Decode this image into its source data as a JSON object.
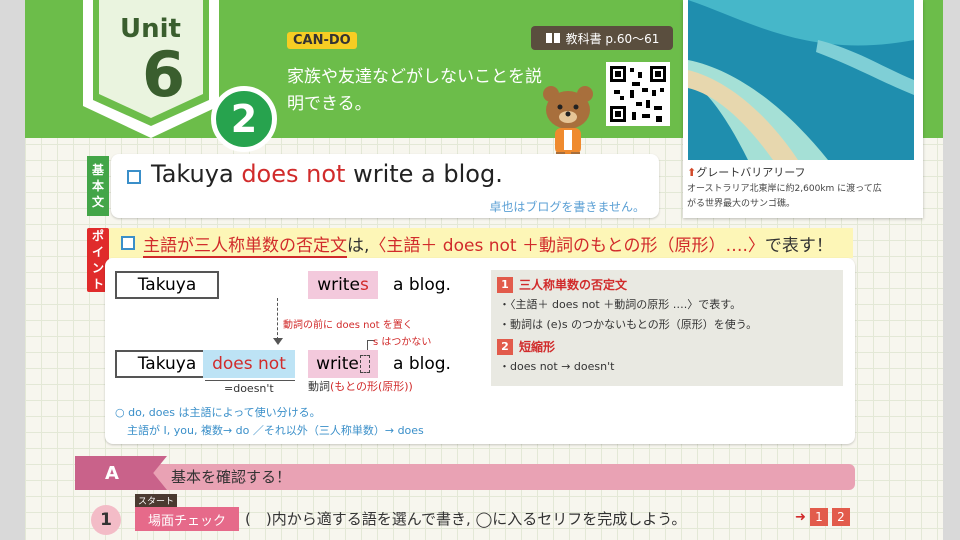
{
  "unit": {
    "word": "Unit",
    "number": "6",
    "part": "2"
  },
  "cando": {
    "label": "CAN-DO",
    "text": "家族や友達などがしないことを説明できる。"
  },
  "textbook": {
    "icon": "book-icon",
    "label": "教科書 p.60〜61"
  },
  "photo": {
    "title": "グレートバリアリーフ",
    "caption": "オーストラリア北東岸に約2,600km に渡って広がる世界最大のサンゴ礁。"
  },
  "basic": {
    "tag": [
      "基",
      "本",
      "文"
    ],
    "sentence_pre": "Takuya ",
    "sentence_red": "does not",
    "sentence_post": " write a blog.",
    "translation": "卓也はブログを書きません。"
  },
  "point": {
    "tag": [
      "ポ",
      "イ",
      "ン",
      "ト"
    ],
    "text_a": "主語が三人称単数の否定文",
    "text_b": "は,",
    "text_c": "〈主語＋ does not ＋動詞のもとの形（原形）….〉",
    "text_d": "で表す！"
  },
  "example": {
    "row1": {
      "subject": "Takuya",
      "verb_base": "write",
      "verb_s": "s",
      "rest": "a blog."
    },
    "row2": {
      "subject": "Takuya",
      "aux": "does not",
      "verb": "write",
      "rest": "a blog."
    },
    "note_place": "動詞の前に does not を置く",
    "note_s": "s はつかない",
    "doesnt": "=doesn't",
    "verb_label": "動詞",
    "verb_label_red": "(もとの形(原形))",
    "bottom_note1": "○ do, does は主語によって使い分ける。",
    "bottom_note2": "主語が I, you, 複数→ do ／それ以外（三人称単数）→ does"
  },
  "sidebox": {
    "h1_num": "1",
    "h1": "三人称単数の否定文",
    "t1": "・〈主語＋ does not ＋動詞の原形 ….〉で表す。",
    "t2": "・動詞は (e)s のつかないもとの形（原形）を使う。",
    "h2_num": "2",
    "h2": "短縮形",
    "t3": "・does not → doesn't"
  },
  "sectionA": {
    "letter": "A",
    "title": "基本を確認する！"
  },
  "q1": {
    "num": "1",
    "start": "スタート",
    "scene": "場面チェック",
    "text": "(　)内から適する語を選んで書き, ◯に入るセリフを完成しよう。",
    "ref_arrow": "➜",
    "refs": [
      "1",
      "2"
    ]
  }
}
